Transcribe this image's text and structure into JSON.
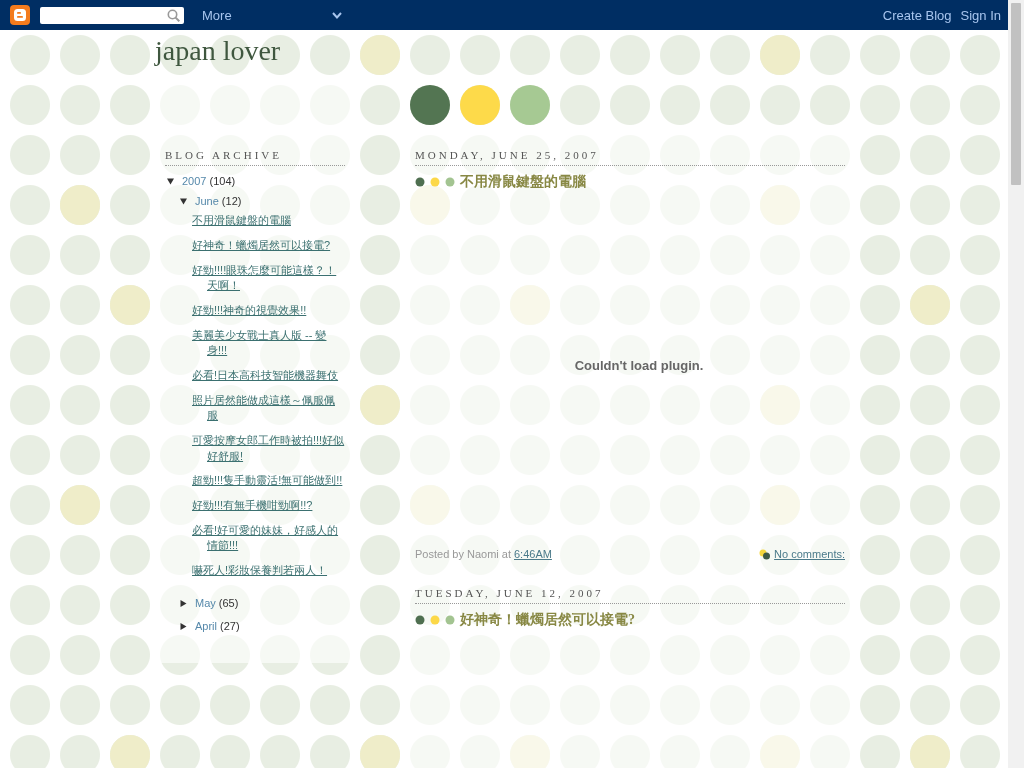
{
  "navbar": {
    "menu_label": "More",
    "links": [
      "Create Blog",
      "Sign In"
    ]
  },
  "blog": {
    "title": "japan lover"
  },
  "sidebar": {
    "heading": "BLOG ARCHIVE",
    "archive": [
      {
        "label": "2007",
        "count": "(104)",
        "expanded": true,
        "children": [
          {
            "label": "June",
            "count": "(12)",
            "expanded": true,
            "children": [
              {
                "label": "不用滑鼠鍵盤的電腦"
              },
              {
                "label": "好神奇！蠟燭居然可以接電?"
              },
              {
                "label": "好勁!!!!眼珠怎麼可能這樣？！天啊！"
              },
              {
                "label": "好勁!!!神奇的視覺效果!!"
              },
              {
                "label": "美麗美少女戰士真人版 -- 變身!!!"
              },
              {
                "label": "必看!日本高科技智能機器舞伎"
              },
              {
                "label": "照片居然能做成這樣～佩服佩服"
              },
              {
                "label": "可愛按摩女郎工作時被拍!!!好似好舒服!"
              },
              {
                "label": "超勁!!!隻手動靈活!無可能做到!!"
              },
              {
                "label": "好勁!!!有無手機咁勁啊!!?"
              },
              {
                "label": "必看!好可愛的妹妹，好感人的情節!!!"
              },
              {
                "label": "嚇死人!彩妝保養判若兩人！"
              }
            ]
          },
          {
            "label": "May",
            "count": "(65)",
            "expanded": false
          },
          {
            "label": "April",
            "count": "(27)",
            "expanded": false
          }
        ]
      }
    ]
  },
  "posts": [
    {
      "date": "MONDAY, JUNE 25, 2007",
      "title": "不用滑鼠鍵盤的電腦",
      "plugin_message": "Couldn't load plugin.",
      "byline": "Posted by Naomi at",
      "time": "6:46AM",
      "comments": "No comments:"
    },
    {
      "date": "TUESDAY, JUNE 12, 2007",
      "title": "好神奇！蠟燭居然可以接電?"
    }
  ]
}
